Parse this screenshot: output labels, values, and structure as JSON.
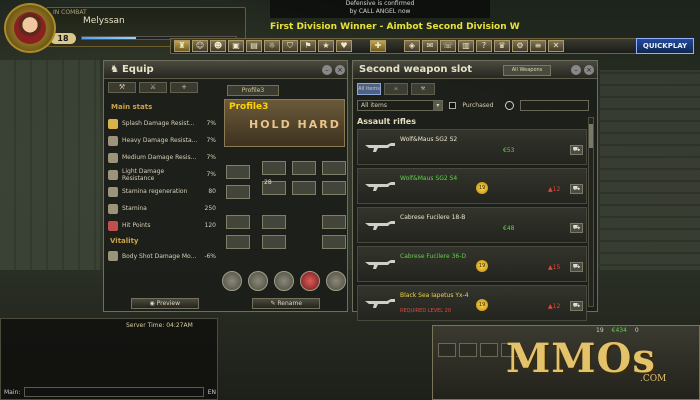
{
  "player": {
    "name": "Melyssan",
    "tag": "IN COMBAT",
    "level": "18",
    "xp_fraction": 0.35
  },
  "announcement": {
    "line1": "Defensive is confirmed",
    "line2": "by CALL ANGEL now"
  },
  "ticker": "First Division Winner - Aimbot Second Division W",
  "quickplay_label": "QUICKPLAY",
  "equip": {
    "title": "Equip",
    "profile_tab": "Profile3",
    "profile_label": "Profile3",
    "banner_text": "HOLD HARD",
    "main_stats_title": "Main stats",
    "stats": [
      {
        "name": "Splash Damage Resist...",
        "value": "7%",
        "icon": "explosion-icon"
      },
      {
        "name": "Heavy Damage Resista...",
        "value": "7%",
        "icon": "shield-icon"
      },
      {
        "name": "Medium Damage Resis...",
        "value": "7%",
        "icon": "shield-icon"
      },
      {
        "name": "Light Damage Resistance",
        "value": "7%",
        "icon": "shield-icon"
      },
      {
        "name": "Stamina regeneration",
        "value": "80",
        "icon": "run-icon"
      },
      {
        "name": "Stamina",
        "value": "250",
        "icon": "run-icon"
      },
      {
        "name": "Hit Points",
        "value": "120",
        "icon": "heart-icon"
      }
    ],
    "vitality_title": "Vitality",
    "vitality": {
      "name": "Body Shot Damage Mo...",
      "value": "-6%"
    },
    "slot_number": "28",
    "preview_label": "Preview",
    "rename_label": "Rename"
  },
  "weapon": {
    "title": "Second weapon slot",
    "top_button": "All Weapons",
    "tab_all": "All items",
    "filter_select": "All items",
    "purchased_label": "Purchased",
    "category": "Assault rifles",
    "items": [
      {
        "name": "Wolf&Maus SG2 S2",
        "name_color": "white",
        "price": "€53",
        "rank": "",
        "alert": "",
        "req": ""
      },
      {
        "name": "Wolf&Maus SG2 S4",
        "name_color": "green",
        "price": "",
        "rank": "19",
        "alert": "12",
        "req": ""
      },
      {
        "name": "Cabrese Fucilere 18-B",
        "name_color": "white",
        "price": "€48",
        "rank": "",
        "alert": "",
        "req": ""
      },
      {
        "name": "Cabrese Fucilere 36-D",
        "name_color": "green",
        "price": "",
        "rank": "19",
        "alert": "15",
        "req": ""
      },
      {
        "name": "Black Sea Iapetus Yx-4",
        "name_color": "white",
        "price": "",
        "rank": "19",
        "alert": "12",
        "req": "REQUIRED LEVEL 20"
      }
    ]
  },
  "server_time": "Server Time: 04:27AM",
  "chat": {
    "label": "Main:",
    "lang": "EN"
  },
  "currency": {
    "gold": "19",
    "credits": "€434",
    "tokens": "0"
  },
  "logo": {
    "main": "MMOs",
    "sub": ".COM"
  }
}
